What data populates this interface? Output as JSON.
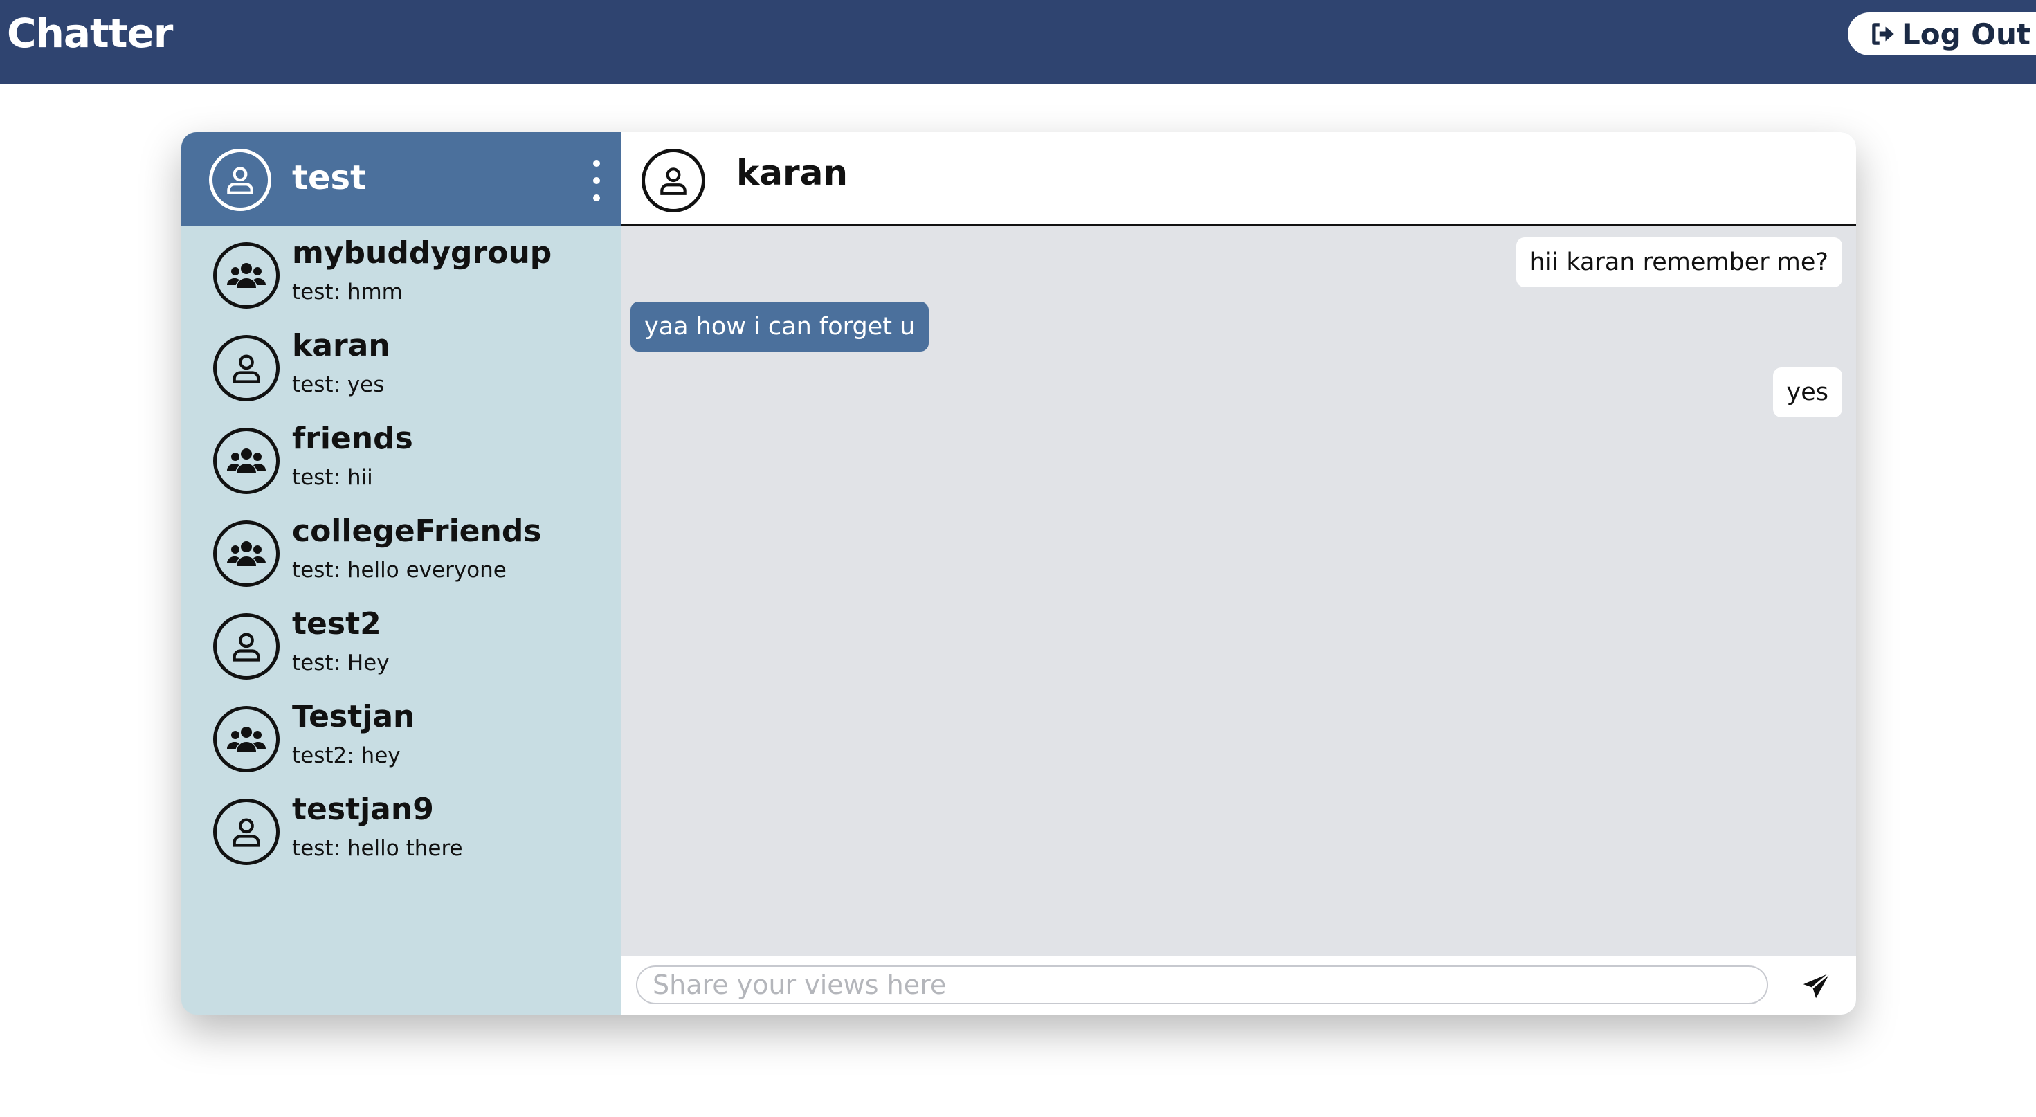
{
  "app": {
    "title": "Chatter",
    "logout_label": "Log Out"
  },
  "sidebar": {
    "current_user": "test",
    "chats": [
      {
        "name": "mybuddygroup",
        "preview": "test: hmm",
        "type": "group"
      },
      {
        "name": "karan",
        "preview": "test: yes",
        "type": "user"
      },
      {
        "name": "friends",
        "preview": "test: hii",
        "type": "group"
      },
      {
        "name": "collegeFriends",
        "preview": "test: hello everyone",
        "type": "group"
      },
      {
        "name": "test2",
        "preview": "test: Hey",
        "type": "user"
      },
      {
        "name": "Testjan",
        "preview": "test2: hey",
        "type": "group"
      },
      {
        "name": "testjan9",
        "preview": "test: hello there",
        "type": "user"
      }
    ]
  },
  "conversation": {
    "contact_name": "karan",
    "messages": [
      {
        "text": "hii karan remember me?",
        "direction": "outgoing"
      },
      {
        "text": "yaa how i can forget u",
        "direction": "incoming"
      },
      {
        "text": "yes",
        "direction": "outgoing"
      }
    ]
  },
  "composer": {
    "placeholder": "Share your views here",
    "value": ""
  },
  "colors": {
    "topbar": "#2f4470",
    "sidebar_header": "#4b709c",
    "sidebar_bg": "#c8dde3",
    "chat_bg": "#e1e3e7",
    "incoming_bubble": "#4b709c"
  }
}
